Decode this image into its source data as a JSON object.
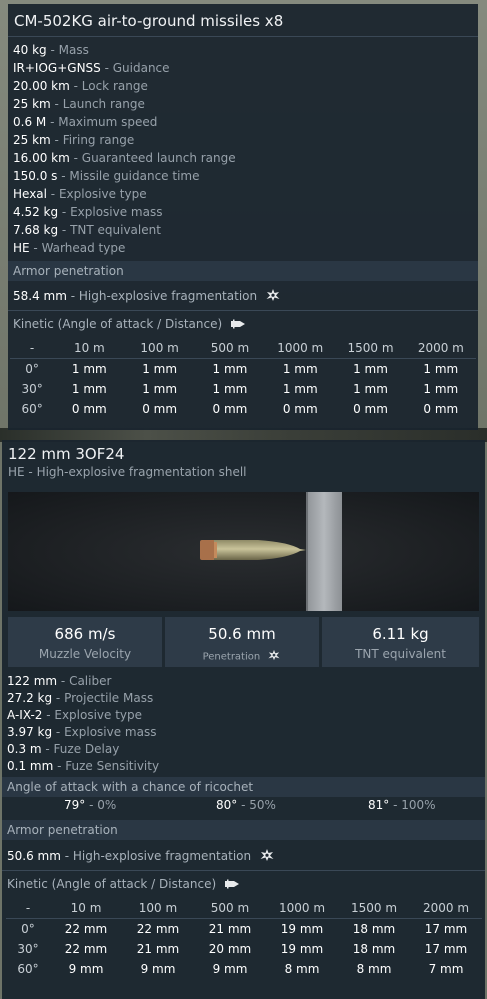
{
  "panel1": {
    "title": "CM-502KG air-to-ground missiles x8",
    "stats": [
      {
        "value": "40 kg",
        "label": " - Mass"
      },
      {
        "value": "IR+IOG+GNSS",
        "label": " - Guidance"
      },
      {
        "value": "20.00 km",
        "label": " - Lock range"
      },
      {
        "value": "25 km",
        "label": " - Launch range"
      },
      {
        "value": "0.6 M",
        "label": " - Maximum speed"
      },
      {
        "value": "25 km",
        "label": " - Firing range"
      },
      {
        "value": "16.00 km",
        "label": " - Guaranteed launch range"
      },
      {
        "value": "150.0 s",
        "label": " - Missile guidance time"
      },
      {
        "value": "Hexal",
        "label": " - Explosive type"
      },
      {
        "value": "4.52 kg",
        "label": " - Explosive mass"
      },
      {
        "value": "7.68 kg",
        "label": " - TNT equivalent"
      },
      {
        "value": "HE",
        "label": " - Warhead type"
      }
    ],
    "armor_header": "Armor penetration",
    "he_value": "58.4 mm",
    "he_label": " - High-explosive fragmentation",
    "kinetic_label": "Kinetic (Angle of attack / Distance)",
    "table": {
      "header": [
        "-",
        "10 m",
        "100 m",
        "500 m",
        "1000 m",
        "1500 m",
        "2000 m"
      ],
      "rows": [
        [
          "0°",
          "1 mm",
          "1 mm",
          "1 mm",
          "1 mm",
          "1 mm",
          "1 mm"
        ],
        [
          "30°",
          "1 mm",
          "1 mm",
          "1 mm",
          "1 mm",
          "1 mm",
          "1 mm"
        ],
        [
          "60°",
          "0 mm",
          "0 mm",
          "0 mm",
          "0 mm",
          "0 mm",
          "0 mm"
        ]
      ]
    }
  },
  "panel2": {
    "title": "122 mm 3OF24",
    "subtitle": "HE - High-explosive fragmentation shell",
    "cards": [
      {
        "value": "686 m/s",
        "label": "Muzzle Velocity"
      },
      {
        "value": "50.6 mm",
        "label": "Penetration"
      },
      {
        "value": "6.11 kg",
        "label": "TNT equivalent"
      }
    ],
    "stats": [
      {
        "value": "122 mm",
        "label": " - Caliber"
      },
      {
        "value": "27.2 kg",
        "label": " - Projectile Mass"
      },
      {
        "value": "A-IX-2",
        "label": " - Explosive type"
      },
      {
        "value": "3.97 kg",
        "label": " - Explosive mass"
      },
      {
        "value": "0.3 m",
        "label": " - Fuze Delay"
      },
      {
        "value": "0.1 mm",
        "label": " - Fuze Sensitivity"
      }
    ],
    "ricochet_header": "Angle of attack with a chance of ricochet",
    "ricochet": [
      {
        "angle": "79°",
        "chance": " - 0%"
      },
      {
        "angle": "80°",
        "chance": " - 50%"
      },
      {
        "angle": "81°",
        "chance": " - 100%"
      }
    ],
    "armor_header": "Armor penetration",
    "he_value": "50.6 mm",
    "he_label": " - High-explosive fragmentation",
    "kinetic_label": "Kinetic (Angle of attack / Distance)",
    "table": {
      "header": [
        "-",
        "10 m",
        "100 m",
        "500 m",
        "1000 m",
        "1500 m",
        "2000 m"
      ],
      "rows": [
        [
          "0°",
          "22 mm",
          "22 mm",
          "21 mm",
          "19 mm",
          "18 mm",
          "17 mm"
        ],
        [
          "30°",
          "22 mm",
          "21 mm",
          "20 mm",
          "19 mm",
          "18 mm",
          "17 mm"
        ],
        [
          "60°",
          "9 mm",
          "9 mm",
          "9 mm",
          "8 mm",
          "8 mm",
          "7 mm"
        ]
      ]
    }
  },
  "icons": {
    "he": "explosion-icon",
    "kinetic": "shell-icon"
  },
  "colors": {
    "panel_bg": "#1a242e",
    "section_bg": "#2a3744",
    "value_text": "#ffffff",
    "label_text": "#97a1aa"
  }
}
